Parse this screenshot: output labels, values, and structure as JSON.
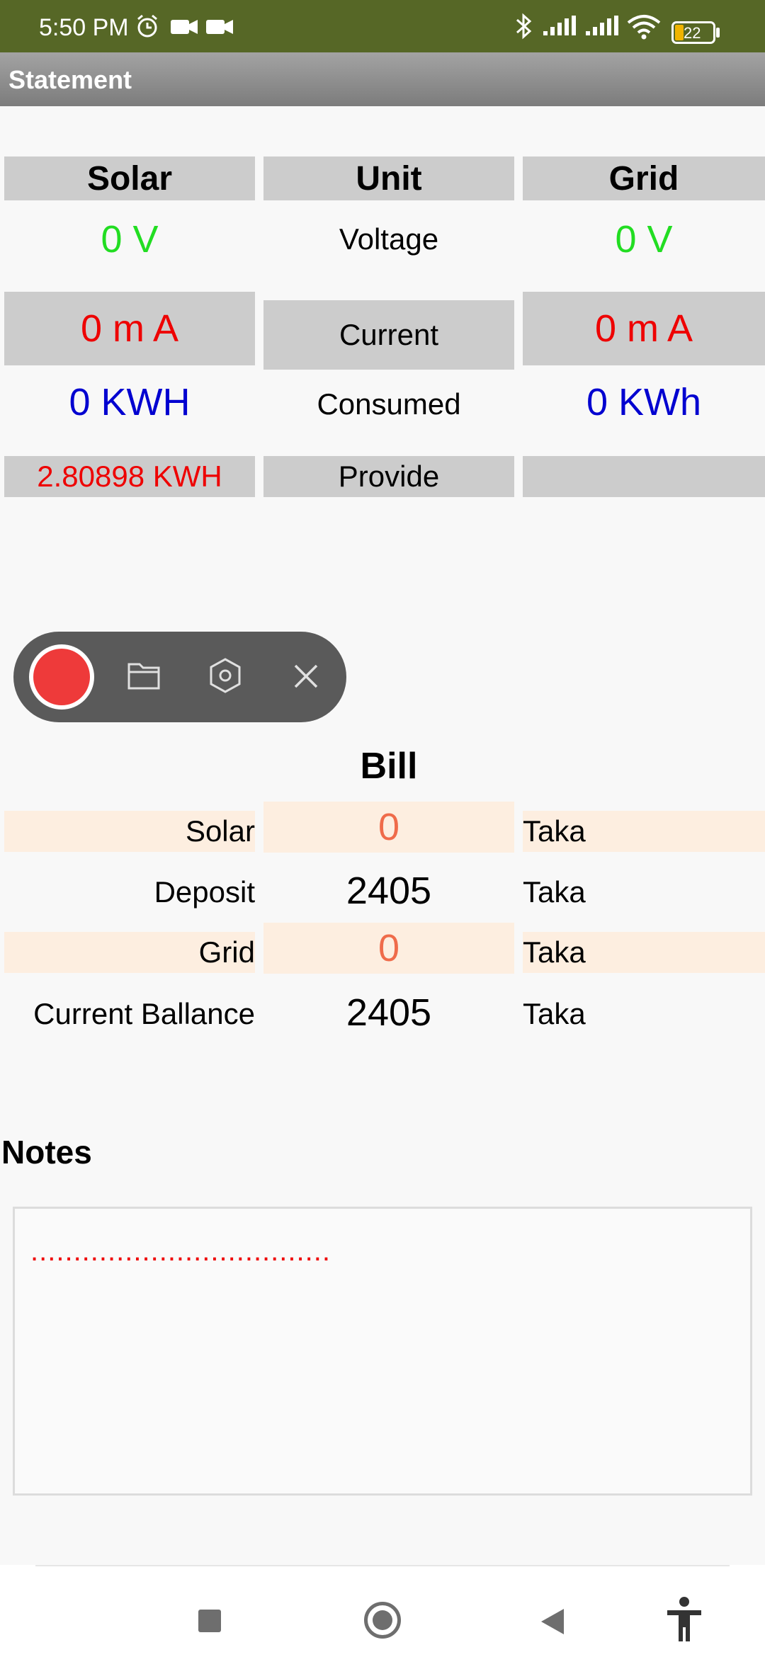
{
  "status_bar": {
    "time": "5:50 PM",
    "battery": "22"
  },
  "app_bar": {
    "title": "Statement"
  },
  "readings": {
    "headers": {
      "solar": "Solar",
      "unit": "Unit",
      "grid": "Grid"
    },
    "voltage": {
      "solar": "0  V",
      "label": "Voltage",
      "grid": "0  V"
    },
    "current": {
      "solar": "0 m A",
      "label": "Current",
      "grid": "0 m A"
    },
    "consumed": {
      "solar": "0  KWH",
      "label": "Consumed",
      "grid": "0  KWh"
    },
    "provide": {
      "solar": "2.80898  KWH",
      "label": "Provide",
      "grid": ""
    }
  },
  "bill": {
    "title": "Bill",
    "rows": [
      {
        "label": "Solar",
        "value": "0",
        "unit": "Taka"
      },
      {
        "label": "Deposit",
        "value": "2405",
        "unit": "Taka"
      },
      {
        "label": "Grid",
        "value": "0",
        "unit": "Taka"
      },
      {
        "label": "Current Ballance",
        "value": "2405",
        "unit": "Taka"
      }
    ]
  },
  "notes": {
    "title": "Notes",
    "text": "..................................."
  },
  "colors": {
    "status_bar": "#566726",
    "green": "#22dd22",
    "red": "#ee0000",
    "blue": "#0000d0",
    "orange": "#ef6b4a",
    "peach": "#fdeee0"
  },
  "icons": [
    "alarm-icon",
    "video-icon",
    "bluetooth-icon",
    "signal-icon",
    "wifi-icon",
    "battery-icon",
    "record-icon",
    "folder-icon",
    "settings-icon",
    "close-icon",
    "square-icon",
    "home-icon",
    "back-icon",
    "accessibility-icon"
  ]
}
